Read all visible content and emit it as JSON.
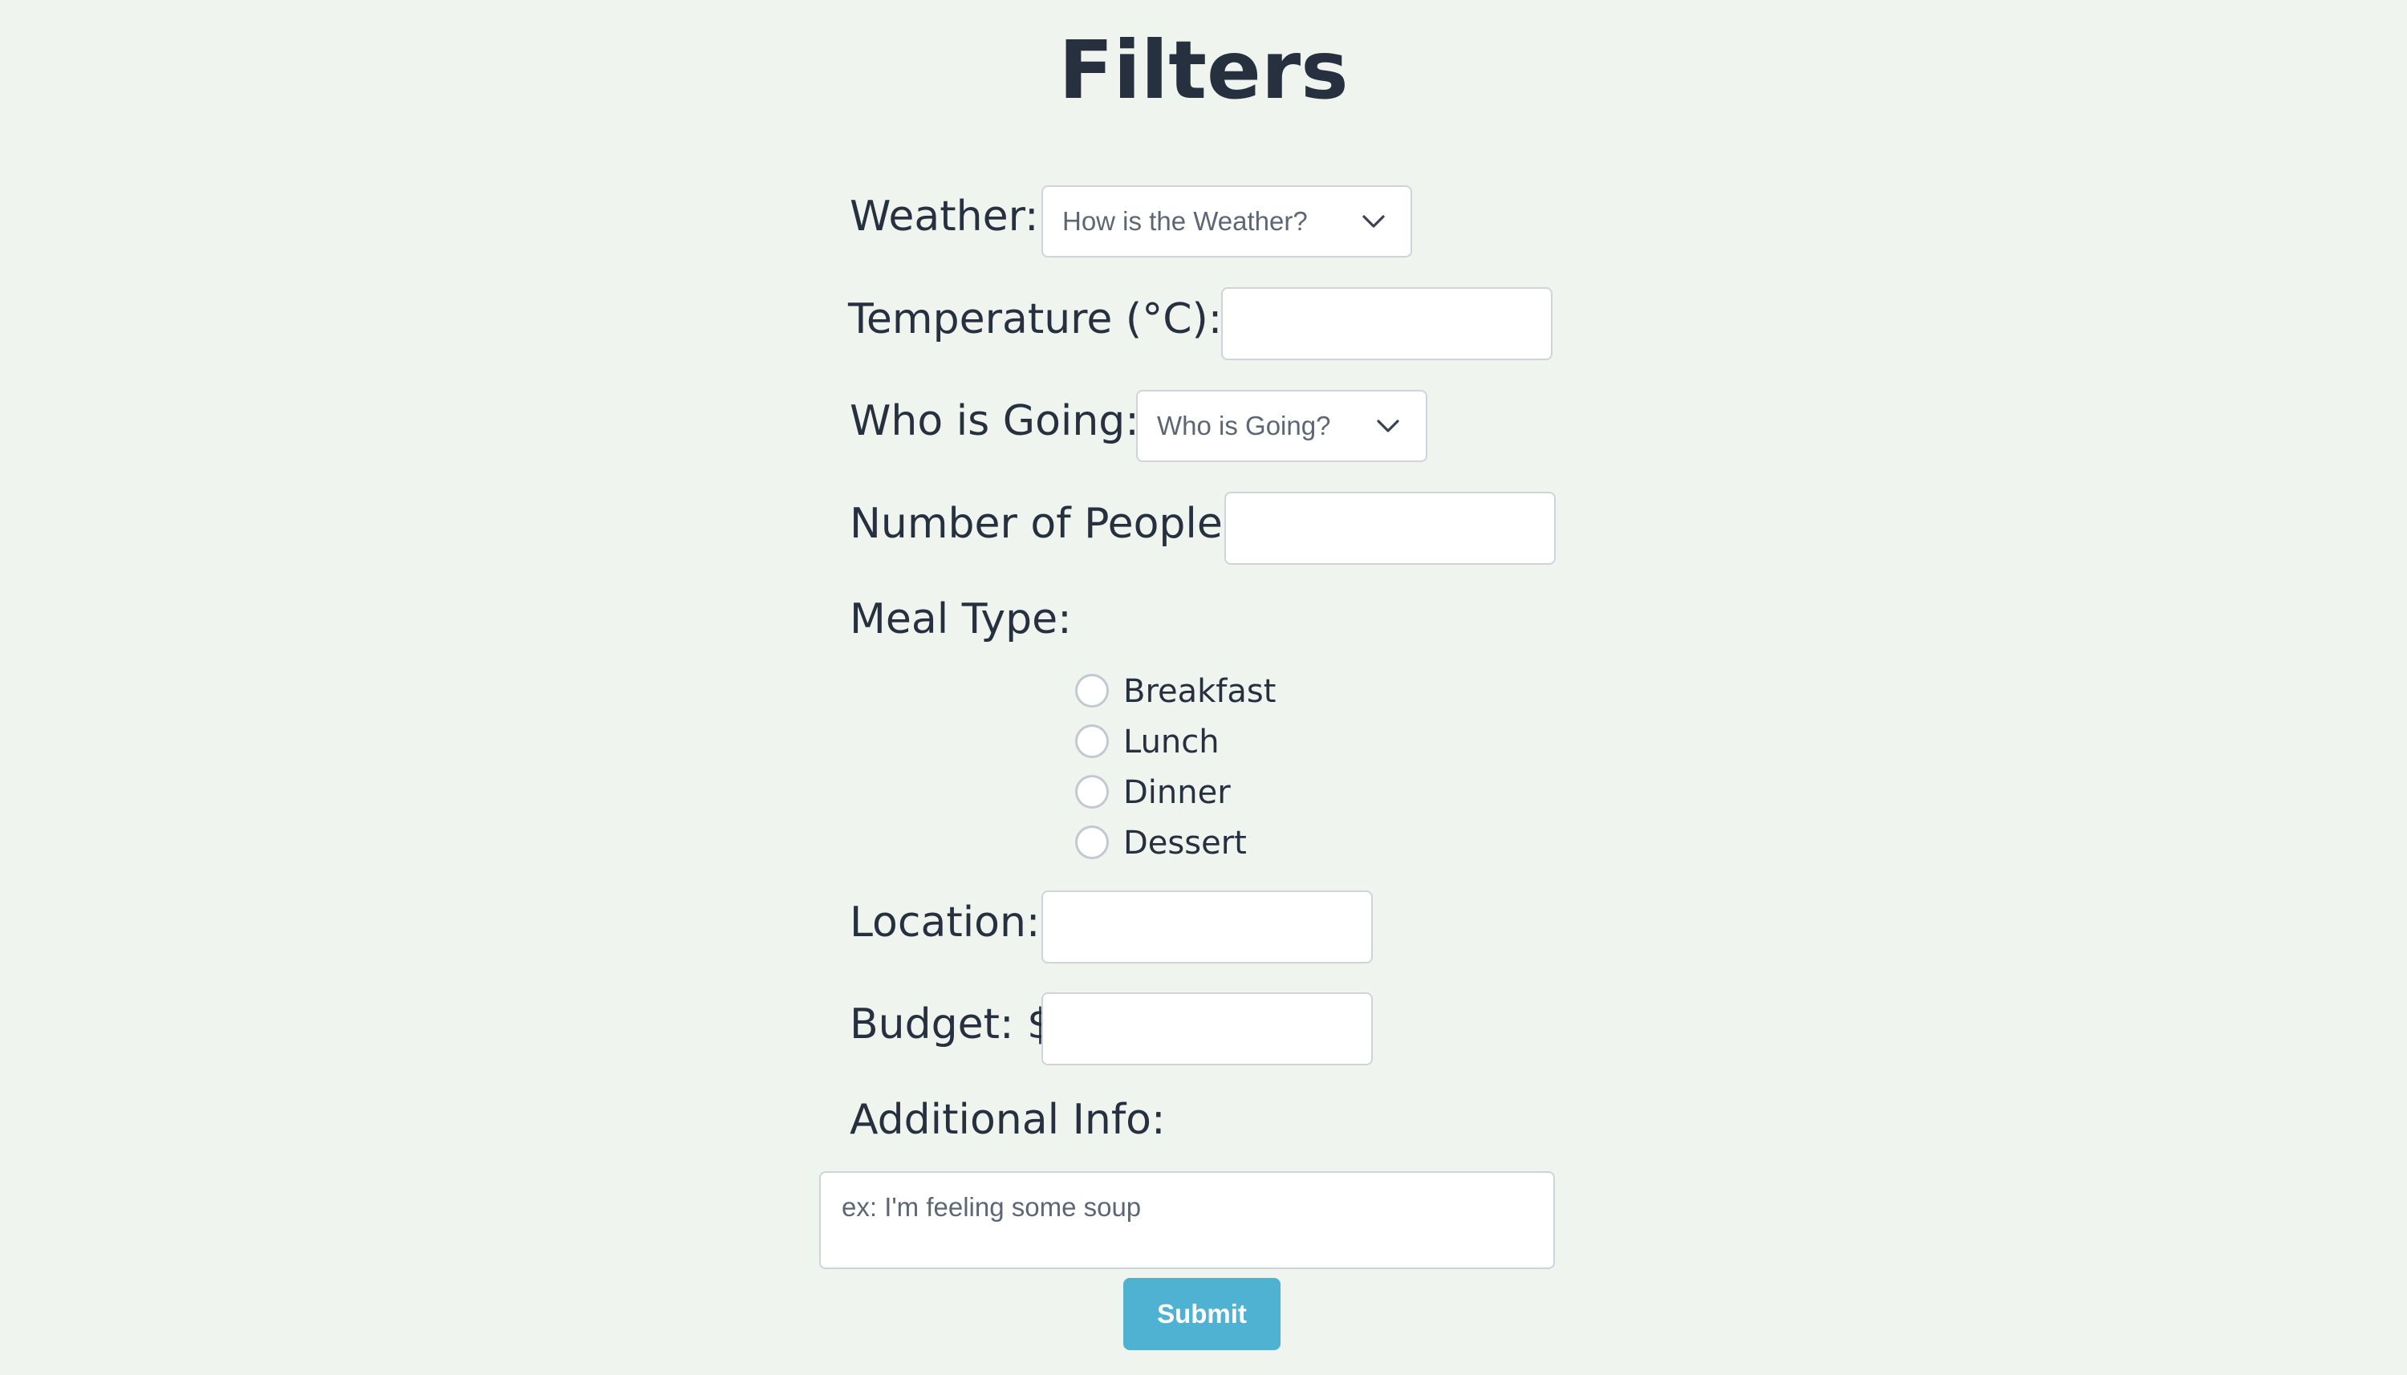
{
  "title": "Filters",
  "weather": {
    "label": "Weather:",
    "selected": "How is the Weather?"
  },
  "temperature": {
    "label": "Temperature (°C):",
    "value": ""
  },
  "who_is_going": {
    "label": "Who is Going:",
    "selected": "Who is Going?"
  },
  "number_of_people": {
    "label": "Number of People:",
    "value": ""
  },
  "meal_type": {
    "label": "Meal Type:",
    "options": [
      "Breakfast",
      "Lunch",
      "Dinner",
      "Dessert"
    ]
  },
  "location": {
    "label": "Location:",
    "value": ""
  },
  "budget": {
    "label": "Budget: $",
    "value": ""
  },
  "additional_info": {
    "label": "Additional Info:",
    "placeholder": "ex: I'm feeling some soup"
  },
  "submit_label": "Submit",
  "colors": {
    "background": "#eff4ef",
    "text": "#27303f",
    "submit": "#4fb2d2"
  }
}
